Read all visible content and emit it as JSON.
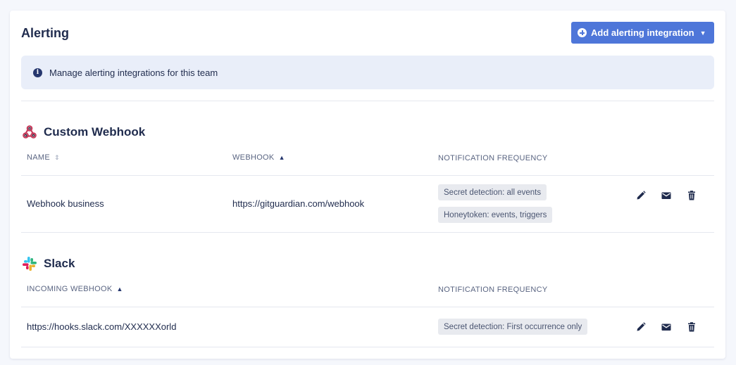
{
  "page": {
    "title": "Alerting",
    "add_button_label": "Add alerting integration",
    "info_text": "Manage alerting integrations for this team"
  },
  "custom_webhook": {
    "title": "Custom Webhook",
    "columns": {
      "name": "NAME",
      "webhook": "WEBHOOK",
      "frequency": "NOTIFICATION FREQUENCY"
    },
    "rows": [
      {
        "name": "Webhook business",
        "webhook": "https://gitguardian.com/webhook",
        "frequency": [
          "Secret detection: all events",
          "Honeytoken: events, triggers"
        ]
      }
    ]
  },
  "slack": {
    "title": "Slack",
    "columns": {
      "incoming_webhook": "INCOMING WEBHOOK",
      "frequency": "NOTIFICATION FREQUENCY"
    },
    "rows": [
      {
        "incoming_webhook": "https://hooks.slack.com/XXXXXXorld",
        "frequency": [
          "Secret detection: First occurrence only"
        ]
      }
    ]
  },
  "colors": {
    "accent": "#4e76d9",
    "text": "#1f2b4d",
    "info_bg": "#e9eef9",
    "badge_bg": "#e8eaef"
  },
  "icons": [
    "plus-circle-icon",
    "chevron-down-icon",
    "info-icon",
    "webhook-icon",
    "slack-icon",
    "sort-icon",
    "sort-up-icon",
    "edit-icon",
    "mail-icon",
    "trash-icon"
  ]
}
